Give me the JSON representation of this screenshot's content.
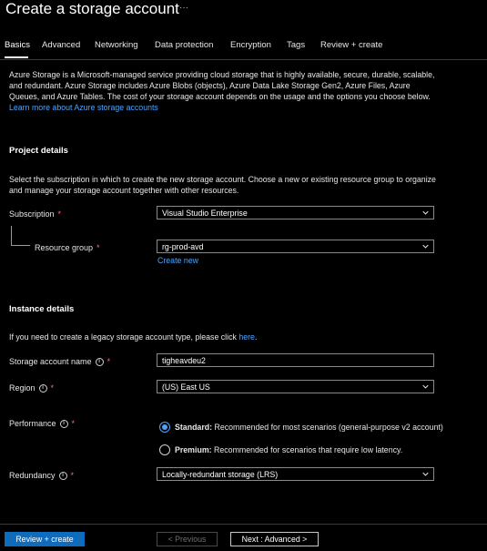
{
  "page": {
    "title": "Create a storage account",
    "more": "···"
  },
  "tabs": [
    {
      "label": "Basics",
      "active": true
    },
    {
      "label": "Advanced"
    },
    {
      "label": "Networking"
    },
    {
      "label": "Data protection"
    },
    {
      "label": "Encryption"
    },
    {
      "label": "Tags"
    },
    {
      "label": "Review + create"
    }
  ],
  "intro": {
    "text": "Azure Storage is a Microsoft-managed service providing cloud storage that is highly available, secure, durable, scalable, and redundant. Azure Storage includes Azure Blobs (objects), Azure Data Lake Storage Gen2, Azure Files, Azure Queues, and Azure Tables. The cost of your storage account depends on the usage and the options you choose below.",
    "link": "Learn more about Azure storage accounts"
  },
  "project": {
    "title": "Project details",
    "description": "Select the subscription in which to create the new storage account. Choose a new or existing resource group to organize and manage your storage account together with other resources.",
    "subscription_label": "Subscription",
    "subscription_value": "Visual Studio Enterprise",
    "resource_group_label": "Resource group",
    "resource_group_value": "rg-prod-avd",
    "create_new": "Create new",
    "required_mark": "*"
  },
  "instance": {
    "title": "Instance details",
    "legacy_text": "If you need to create a legacy storage account type, please click",
    "legacy_link": "here",
    "legacy_end": ".",
    "name_label": "Storage account name",
    "name_value": "tigheavdeu2",
    "region_label": "Region",
    "region_value": "(US) East US",
    "performance_label": "Performance",
    "performance_options": [
      {
        "title": "Standard:",
        "desc": "Recommended for most scenarios (general-purpose v2 account)",
        "selected": true
      },
      {
        "title": "Premium:",
        "desc": "Recommended for scenarios that require low latency.",
        "selected": false
      }
    ],
    "redundancy_label": "Redundancy",
    "redundancy_value": "Locally-redundant storage (LRS)",
    "info_glyph": "i"
  },
  "footer": {
    "review_create": "Review + create",
    "previous": "< Previous",
    "next": "Next : Advanced >"
  },
  "colors": {
    "accent": "#0f6cbd",
    "link": "#4fa3f7",
    "required": "#f1707b",
    "background": "#000000"
  }
}
